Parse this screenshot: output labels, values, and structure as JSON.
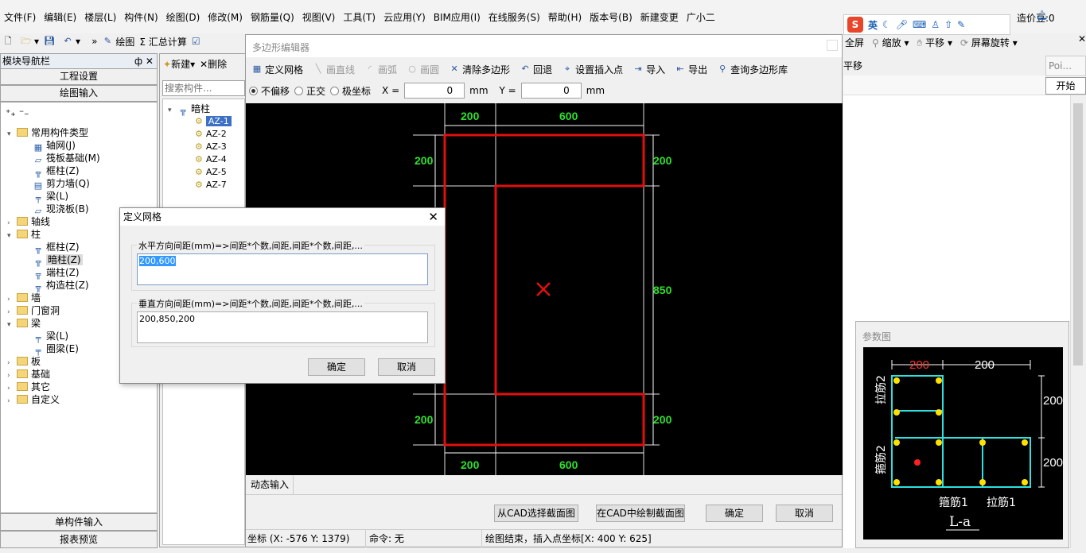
{
  "menu": [
    "文件(F)",
    "编辑(E)",
    "楼层(L)",
    "构件(N)",
    "绘图(D)",
    "修改(M)",
    "钢筋量(Q)",
    "视图(V)",
    "工具(T)",
    "云应用(Y)",
    "BIM应用(I)",
    "在线服务(S)",
    "帮助(H)",
    "版本号(B)",
    "新建变更",
    "广小二"
  ],
  "ime": {
    "brand": "S",
    "lang": "英",
    "user_bean": "造价豆:0"
  },
  "toolbar_left": {
    "draw": "绘图",
    "sum": "Σ 汇总计算"
  },
  "toolbar_right": {
    "fullscreen": "全屏",
    "zoom": "缩放",
    "pan": "平移",
    "rotate": "屏幕旋转",
    "move": "平移"
  },
  "nav": {
    "title": "模块导航栏",
    "pin": "ф ✕",
    "btn_project": "工程设置",
    "btn_draw": "绘图输入",
    "tree": [
      {
        "label": "常用构件类型",
        "level": 0,
        "type": "folder",
        "exp": "▾"
      },
      {
        "label": "轴网(J)",
        "level": 1,
        "type": "grid"
      },
      {
        "label": "筏板基础(M)",
        "level": 1,
        "type": "slab"
      },
      {
        "label": "框柱(Z)",
        "level": 1,
        "type": "col"
      },
      {
        "label": "剪力墙(Q)",
        "level": 1,
        "type": "wall"
      },
      {
        "label": "梁(L)",
        "level": 1,
        "type": "beam"
      },
      {
        "label": "现浇板(B)",
        "level": 1,
        "type": "slab"
      },
      {
        "label": "轴线",
        "level": 0,
        "type": "folder",
        "exp": "›"
      },
      {
        "label": "柱",
        "level": 0,
        "type": "folder",
        "exp": "▾"
      },
      {
        "label": "框柱(Z)",
        "level": 1,
        "type": "col"
      },
      {
        "label": "暗柱(Z)",
        "level": 1,
        "type": "col",
        "selected": true
      },
      {
        "label": "端柱(Z)",
        "level": 1,
        "type": "col"
      },
      {
        "label": "构造柱(Z)",
        "level": 1,
        "type": "col"
      },
      {
        "label": "墙",
        "level": 0,
        "type": "folder",
        "exp": "›"
      },
      {
        "label": "门窗洞",
        "level": 0,
        "type": "folder",
        "exp": "›"
      },
      {
        "label": "梁",
        "level": 0,
        "type": "folder",
        "exp": "▾"
      },
      {
        "label": "梁(L)",
        "level": 1,
        "type": "beam"
      },
      {
        "label": "圈梁(E)",
        "level": 1,
        "type": "beam"
      },
      {
        "label": "板",
        "level": 0,
        "type": "folder",
        "exp": "›"
      },
      {
        "label": "基础",
        "level": 0,
        "type": "folder",
        "exp": "›"
      },
      {
        "label": "其它",
        "level": 0,
        "type": "folder",
        "exp": "›"
      },
      {
        "label": "自定义",
        "level": 0,
        "type": "folder",
        "exp": "›"
      }
    ],
    "btn_single": "单构件输入",
    "btn_report": "报表预览"
  },
  "comp_panel": {
    "new": "新建",
    "delete": "删除",
    "search_placeholder": "搜索构件...",
    "root": "暗柱",
    "items": [
      "AZ-1",
      "AZ-2",
      "AZ-3",
      "AZ-4",
      "AZ-5",
      "AZ-7"
    ]
  },
  "editor": {
    "title": "多边形编辑器",
    "tools": [
      "定义网格",
      "画直线",
      "画弧",
      "画圆",
      "清除多边形",
      "回退",
      "设置插入点",
      "导入",
      "导出",
      "查询多边形库"
    ],
    "modes": [
      "不偏移",
      "正交",
      "极坐标"
    ],
    "x_label": "X =",
    "x_val": "0",
    "unit": "mm",
    "y_label": "Y =",
    "y_val": "0",
    "dyn_tab": "动态输入",
    "btn_from_cad": "从CAD选择截面图",
    "btn_in_cad": "在CAD中绘制截面图",
    "btn_ok": "确定",
    "btn_cancel": "取消",
    "status_coord": "坐标 (X: -576 Y: 1379)",
    "status_cmd": "命令: 无",
    "status_msg": "绘图结束，插入点坐标[X: 400 Y: 625]",
    "dims_top": [
      "200",
      "600"
    ],
    "dims_bottom": [
      "200",
      "600"
    ],
    "dims_right": [
      "200",
      "850",
      "200"
    ],
    "dims_left": [
      "200",
      "200"
    ]
  },
  "grid_dialog": {
    "title": "定义网格",
    "h_label": "水平方向间距(mm)=>间距*个数,间距,间距*个数,间距,...",
    "h_value": "200,600",
    "v_label": "垂直方向间距(mm)=>间距*个数,间距,间距*个数,间距,...",
    "v_value": "200,850,200",
    "ok": "确定",
    "cancel": "取消"
  },
  "right_panel": {
    "poi": "Poi...",
    "start": "开始"
  },
  "param_panel": {
    "title": "参数图",
    "labels": {
      "top_red": "200",
      "top_white": "200",
      "r1": "200",
      "r2": "200",
      "tie2": "拉筋2",
      "hoop2": "箍筋2",
      "hoop1": "箍筋1",
      "tie1": "拉筋1",
      "name": "L-a"
    }
  }
}
